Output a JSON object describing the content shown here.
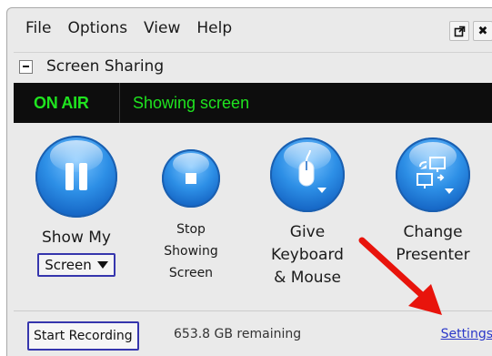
{
  "menu": [
    "File",
    "Options",
    "View",
    "Help"
  ],
  "window_buttons": {
    "popout": "⇱",
    "close": "✖"
  },
  "section": {
    "title": "Screen Sharing"
  },
  "status": {
    "on_air": "ON AIR",
    "text": "Showing screen",
    "color": "#1fe41f"
  },
  "tools": {
    "show": {
      "line1": "Show My",
      "dropdown": "Screen"
    },
    "stop": {
      "line1": "Stop",
      "line2": "Showing",
      "line3": "Screen"
    },
    "give": {
      "line1": "Give",
      "line2": "Keyboard",
      "line3": "& Mouse"
    },
    "change": {
      "line1": "Change",
      "line2": "Presenter"
    }
  },
  "icons": {
    "show": "pause-icon",
    "stop": "stop-icon",
    "give": "mouse-icon",
    "change": "swap-monitors-icon",
    "annotation": "red-arrow"
  },
  "accent_color": "#1667c6",
  "annotation_color": "#e8140c",
  "bottom": {
    "record_button": "Start Recording",
    "remaining": "653.8 GB remaining",
    "settings_link": "Settings"
  }
}
